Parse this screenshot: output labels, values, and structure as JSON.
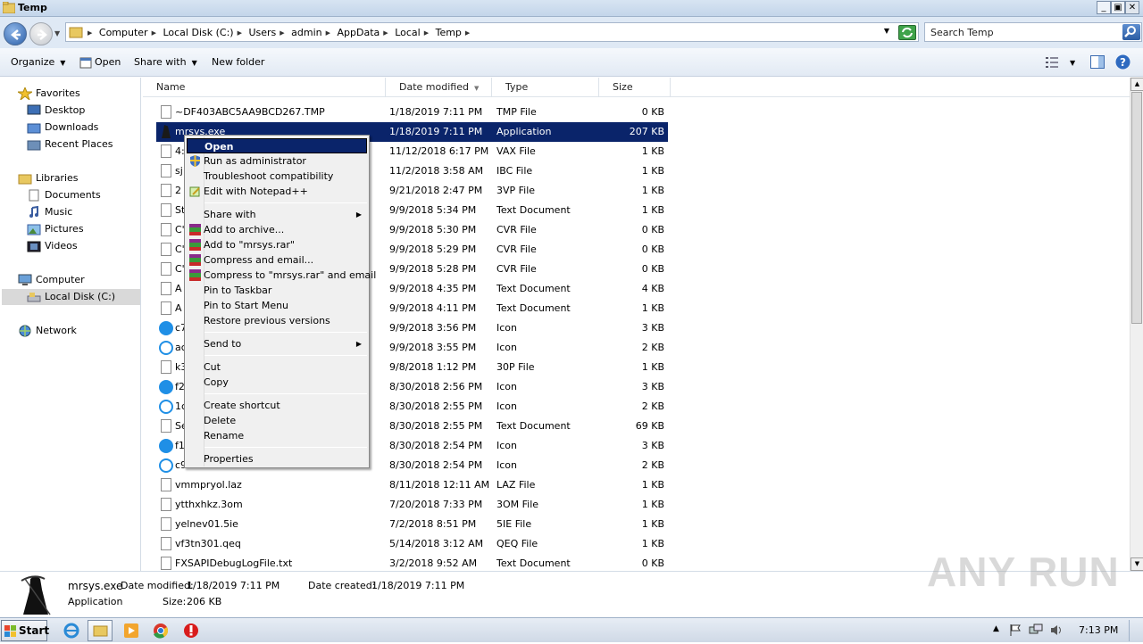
{
  "window": {
    "title": "Temp",
    "min": "_",
    "max": "▣",
    "close": "✕"
  },
  "address": {
    "crumbs": [
      "Computer",
      "Local Disk (C:)",
      "Users",
      "admin",
      "AppData",
      "Local",
      "Temp"
    ],
    "search_placeholder": "Search Temp"
  },
  "toolbar": {
    "organize": "Organize",
    "open": "Open",
    "share_with": "Share with",
    "new_folder": "New folder"
  },
  "nav": {
    "favorites": "Favorites",
    "desktop": "Desktop",
    "downloads": "Downloads",
    "recent": "Recent Places",
    "libraries": "Libraries",
    "documents": "Documents",
    "music": "Music",
    "pictures": "Pictures",
    "videos": "Videos",
    "computer": "Computer",
    "local_disk": "Local Disk (C:)",
    "network": "Network"
  },
  "columns": {
    "name": "Name",
    "date": "Date modified",
    "type": "Type",
    "size": "Size"
  },
  "files": [
    {
      "name": "~DF403ABC5AA9BCD267.TMP",
      "date": "1/18/2019 7:11 PM",
      "type": "TMP File",
      "size": "0 KB",
      "icon": "doc"
    },
    {
      "name": "mrsys.exe",
      "date": "1/18/2019 7:11 PM",
      "type": "Application",
      "size": "207 KB",
      "icon": "app"
    },
    {
      "name": "4:",
      "date": "11/12/2018 6:17 PM",
      "type": "VAX File",
      "size": "1 KB",
      "icon": "doc"
    },
    {
      "name": "sj",
      "date": "11/2/2018 3:58 AM",
      "type": "IBC File",
      "size": "1 KB",
      "icon": "doc"
    },
    {
      "name": "2",
      "date": "9/21/2018 2:47 PM",
      "type": "3VP File",
      "size": "1 KB",
      "icon": "doc"
    },
    {
      "name": "St",
      "date": "9/9/2018 5:34 PM",
      "type": "Text Document",
      "size": "1 KB",
      "icon": "doc"
    },
    {
      "name": "C'",
      "date": "9/9/2018 5:30 PM",
      "type": "CVR File",
      "size": "0 KB",
      "icon": "doc"
    },
    {
      "name": "C'",
      "date": "9/9/2018 5:29 PM",
      "type": "CVR File",
      "size": "0 KB",
      "icon": "doc"
    },
    {
      "name": "C'",
      "date": "9/9/2018 5:28 PM",
      "type": "CVR File",
      "size": "0 KB",
      "icon": "doc"
    },
    {
      "name": "A",
      "date": "9/9/2018 4:35 PM",
      "type": "Text Document",
      "size": "4 KB",
      "icon": "doc"
    },
    {
      "name": "A",
      "date": "9/9/2018 4:11 PM",
      "type": "Text Document",
      "size": "1 KB",
      "icon": "doc"
    },
    {
      "name": "c7",
      "date": "9/9/2018 3:56 PM",
      "type": "Icon",
      "size": "3 KB",
      "icon": "sky"
    },
    {
      "name": "ac",
      "date": "9/9/2018 3:55 PM",
      "type": "Icon",
      "size": "2 KB",
      "icon": "skyo"
    },
    {
      "name": "k3",
      "date": "9/8/2018 1:12 PM",
      "type": "30P File",
      "size": "1 KB",
      "icon": "doc"
    },
    {
      "name": "f2",
      "date": "8/30/2018 2:56 PM",
      "type": "Icon",
      "size": "3 KB",
      "icon": "sky"
    },
    {
      "name": "1c",
      "date": "8/30/2018 2:55 PM",
      "type": "Icon",
      "size": "2 KB",
      "icon": "skyo"
    },
    {
      "name": "Se",
      "date": "8/30/2018 2:55 PM",
      "type": "Text Document",
      "size": "69 KB",
      "icon": "doc"
    },
    {
      "name": "f1",
      "date": "8/30/2018 2:54 PM",
      "type": "Icon",
      "size": "3 KB",
      "icon": "sky"
    },
    {
      "name": "c9",
      "date": "8/30/2018 2:54 PM",
      "type": "Icon",
      "size": "2 KB",
      "icon": "skyo"
    },
    {
      "name": "vmmpryol.laz",
      "date": "8/11/2018 12:11 AM",
      "type": "LAZ File",
      "size": "1 KB",
      "icon": "doc"
    },
    {
      "name": "ytthxhkz.3om",
      "date": "7/20/2018 7:33 PM",
      "type": "3OM File",
      "size": "1 KB",
      "icon": "doc"
    },
    {
      "name": "yelnev01.5ie",
      "date": "7/2/2018 8:51 PM",
      "type": "5IE File",
      "size": "1 KB",
      "icon": "doc"
    },
    {
      "name": "vf3tn301.qeq",
      "date": "5/14/2018 3:12 AM",
      "type": "QEQ File",
      "size": "1 KB",
      "icon": "doc"
    },
    {
      "name": "FXSAPIDebugLogFile.txt",
      "date": "3/2/2018 9:52 AM",
      "type": "Text Document",
      "size": "0 KB",
      "icon": "doc"
    }
  ],
  "context_menu": {
    "open": "Open",
    "run_admin": "Run as administrator",
    "troubleshoot": "Troubleshoot compatibility",
    "notepad": "Edit with Notepad++",
    "share_with": "Share with",
    "add_archive": "Add to archive...",
    "add_rar": "Add to \"mrsys.rar\"",
    "compress_email": "Compress and email...",
    "compress_rar_email": "Compress to \"mrsys.rar\" and email",
    "pin_taskbar": "Pin to Taskbar",
    "pin_start": "Pin to Start Menu",
    "restore": "Restore previous versions",
    "send_to": "Send to",
    "cut": "Cut",
    "copy": "Copy",
    "create_shortcut": "Create shortcut",
    "delete": "Delete",
    "rename": "Rename",
    "properties": "Properties"
  },
  "details": {
    "name": "mrsys.exe",
    "date_modified_label": "Date modified:",
    "date_modified": "1/18/2019 7:11 PM",
    "date_created_label": "Date created:",
    "date_created": "1/18/2019 7:11 PM",
    "type": "Application",
    "size_label": "Size:",
    "size": "206 KB"
  },
  "taskbar": {
    "start": "Start",
    "clock": "7:13 PM"
  },
  "watermark": "ANY RUN"
}
